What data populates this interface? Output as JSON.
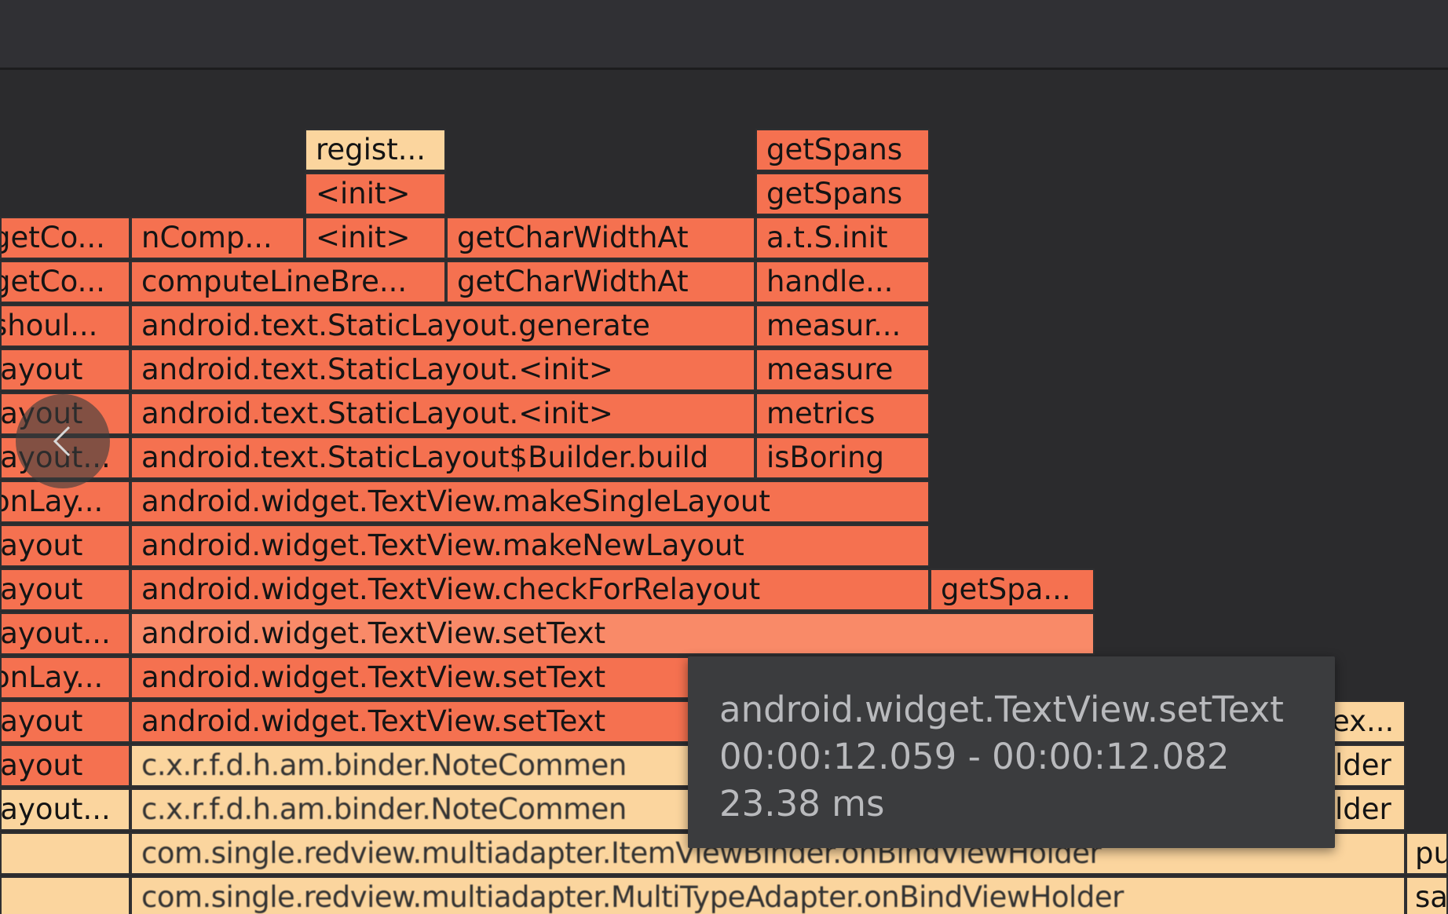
{
  "flame_chart": {
    "rows": [
      {
        "cells": [
          "regist...",
          "getSpans"
        ]
      },
      {
        "cells": [
          "<init>",
          "getSpans"
        ]
      },
      {
        "cells": [
          "getCo...",
          "nComp...",
          "<init>",
          "getCharWidthAt",
          "a.t.S.init"
        ]
      },
      {
        "cells": [
          "getCo...",
          "computeLineBre...",
          "getCharWidthAt",
          "handle..."
        ]
      },
      {
        "cells": [
          "shoul...",
          "android.text.StaticLayout.generate",
          "measur..."
        ]
      },
      {
        "cells": [
          "layout",
          "android.text.StaticLayout.<init>",
          "measure"
        ]
      },
      {
        "cells": [
          "layout",
          "android.text.StaticLayout.<init>",
          "metrics"
        ]
      },
      {
        "cells": [
          "layout...",
          "android.text.StaticLayout$Builder.build",
          "isBoring"
        ]
      },
      {
        "cells": [
          "onLay...",
          "android.widget.TextView.makeSingleLayout"
        ]
      },
      {
        "cells": [
          "layout",
          "android.widget.TextView.makeNewLayout"
        ]
      },
      {
        "cells": [
          "layout",
          "android.widget.TextView.checkForRelayout",
          "getSpa..."
        ]
      },
      {
        "cells": [
          "layout...",
          "android.widget.TextView.setText"
        ]
      },
      {
        "cells": [
          "onLay...",
          "android.widget.TextView.setText"
        ]
      },
      {
        "cells": [
          "layout",
          "android.widget.TextView.setText",
          "ex..."
        ]
      },
      {
        "cells": [
          "layout",
          "c.x.r.f.d.h.am.binder.NoteCommen",
          "lder"
        ]
      },
      {
        "cells": [
          "layout...",
          "c.x.r.f.d.h.am.binder.NoteCommen",
          "lder"
        ]
      },
      {
        "cells": [
          "",
          "com.single.redview.multiadapter.ItemViewBinder.onBindViewHolder",
          "pu"
        ]
      },
      {
        "cells": [
          "",
          "com.single.redview.multiadapter.MultiTypeAdapter.onBindViewHolder",
          "sa"
        ]
      }
    ]
  },
  "tooltip": {
    "method": "android.widget.TextView.setText",
    "time_range": "00:00:12.059 - 00:00:12.082",
    "duration": "23.38 ms"
  },
  "colors": {
    "app_frame": "#f57150",
    "lib_frame": "#fbd59e",
    "hover_frame": "#f98a68",
    "background": "#2b2b2d"
  },
  "nav": {
    "back_icon": "chevron-left-icon"
  }
}
